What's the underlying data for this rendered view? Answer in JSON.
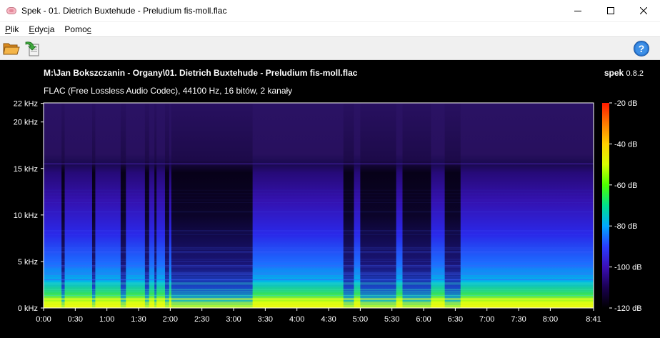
{
  "window": {
    "title": "Spek - 01. Dietrich Buxtehude - Preludium fis-moll.flac",
    "minimize_icon": "minimize-icon",
    "maximize_icon": "maximize-icon",
    "close_icon": "close-icon"
  },
  "menu": {
    "items": [
      {
        "mnemonic": "P",
        "rest": "lik"
      },
      {
        "mnemonic": "E",
        "rest": "dycja"
      },
      {
        "pre": "Pomo",
        "mnemonic": "c",
        "rest": ""
      }
    ]
  },
  "toolbar": {
    "open_icon": "folder-open-icon",
    "save_icon": "save-image-icon",
    "help_icon": "help-icon"
  },
  "spek": {
    "file_title": "M:\\Jan Bokszczanin - Organy\\01. Dietrich Buxtehude - Preludium fis-moll.flac",
    "file_info": "FLAC (Free Lossless Audio Codec), 44100 Hz, 16 bitów, 2 kanały",
    "brand_name": "spek",
    "brand_version": "0.8.2"
  },
  "chart_data": {
    "type": "heatmap",
    "x_axis": {
      "unit": "time",
      "tick_labels": [
        "0:00",
        "0:30",
        "1:00",
        "1:30",
        "2:00",
        "2:30",
        "3:00",
        "3:30",
        "4:00",
        "4:30",
        "5:00",
        "5:30",
        "6:00",
        "6:30",
        "7:00",
        "7:30",
        "8:00",
        "8:41"
      ],
      "tick_seconds": [
        0,
        30,
        60,
        90,
        120,
        150,
        180,
        210,
        240,
        270,
        300,
        330,
        360,
        390,
        420,
        450,
        480,
        521
      ],
      "range_seconds": [
        0,
        521
      ]
    },
    "y_axis": {
      "unit": "kHz",
      "tick_labels": [
        "0 kHz",
        "5 kHz",
        "10 kHz",
        "15 kHz",
        "20 kHz",
        "22 kHz"
      ],
      "tick_values_khz": [
        0,
        5,
        10,
        15,
        20,
        22
      ],
      "range_khz": [
        0,
        22.05
      ]
    },
    "colorbar": {
      "unit": "dB",
      "tick_labels": [
        "-20 dB",
        "-40 dB",
        "-60 dB",
        "-80 dB",
        "-100 dB",
        "-120 dB"
      ],
      "tick_values_db": [
        -20,
        -40,
        -60,
        -80,
        -100,
        -120
      ],
      "range_db": [
        -120,
        -20
      ],
      "colors": [
        "#000000",
        "#1a0050",
        "#3b0fb8",
        "#2a3dff",
        "#00a8ff",
        "#00e08c",
        "#4cff00",
        "#d8ff00",
        "#ffd000",
        "#ff7a00",
        "#ff1a00"
      ]
    },
    "quiet_sections_seconds": [
      [
        17,
        20
      ],
      [
        46,
        49
      ],
      [
        73,
        78
      ],
      [
        96,
        100
      ],
      [
        105,
        107
      ],
      [
        115,
        119
      ],
      [
        121,
        198
      ],
      [
        284,
        294
      ],
      [
        300,
        334
      ],
      [
        340,
        367
      ],
      [
        380,
        395
      ]
    ],
    "cutoff_khz": 15.5
  }
}
